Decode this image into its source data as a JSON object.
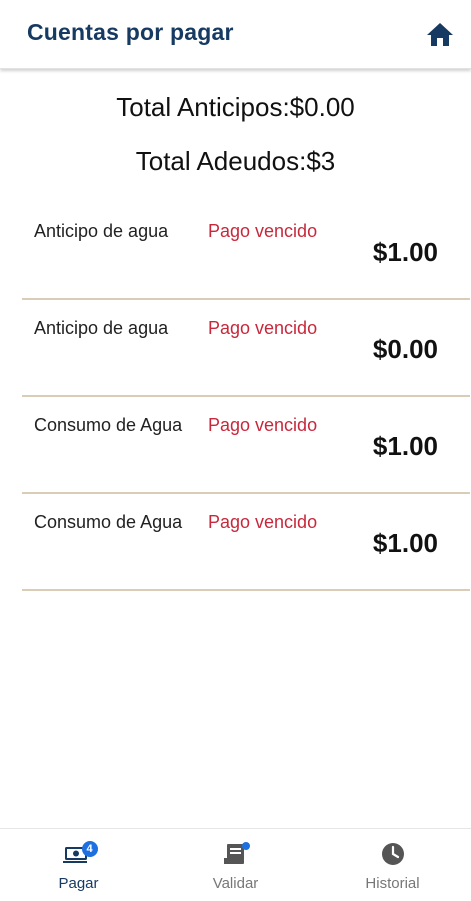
{
  "appbar": {
    "title": "Cuentas por pagar",
    "home_icon": "home-icon"
  },
  "totals": {
    "anticipos": "Total Anticipos:$0.00",
    "adeudos": "Total Adeudos:$3"
  },
  "items": [
    {
      "name": "Anticipo de agua",
      "status": "Pago vencido",
      "amount": "$1.00"
    },
    {
      "name": "Anticipo de agua",
      "status": "Pago vencido",
      "amount": "$0.00"
    },
    {
      "name": "Consumo de Agua",
      "status": "Pago vencido",
      "amount": "$1.00"
    },
    {
      "name": "Consumo de Agua",
      "status": "Pago vencido",
      "amount": "$1.00"
    }
  ],
  "bottom_nav": {
    "items": [
      {
        "label": "Pagar",
        "icon": "payments-icon",
        "badge": "4",
        "active": true
      },
      {
        "label": "Validar",
        "icon": "receipt-icon",
        "active": false
      },
      {
        "label": "Historial",
        "icon": "clock-icon",
        "active": false
      }
    ]
  },
  "colors": {
    "primary": "#173a63",
    "status_red": "#c8283b",
    "divider": "#d9cdb8",
    "badge_blue": "#1e6fe0"
  }
}
